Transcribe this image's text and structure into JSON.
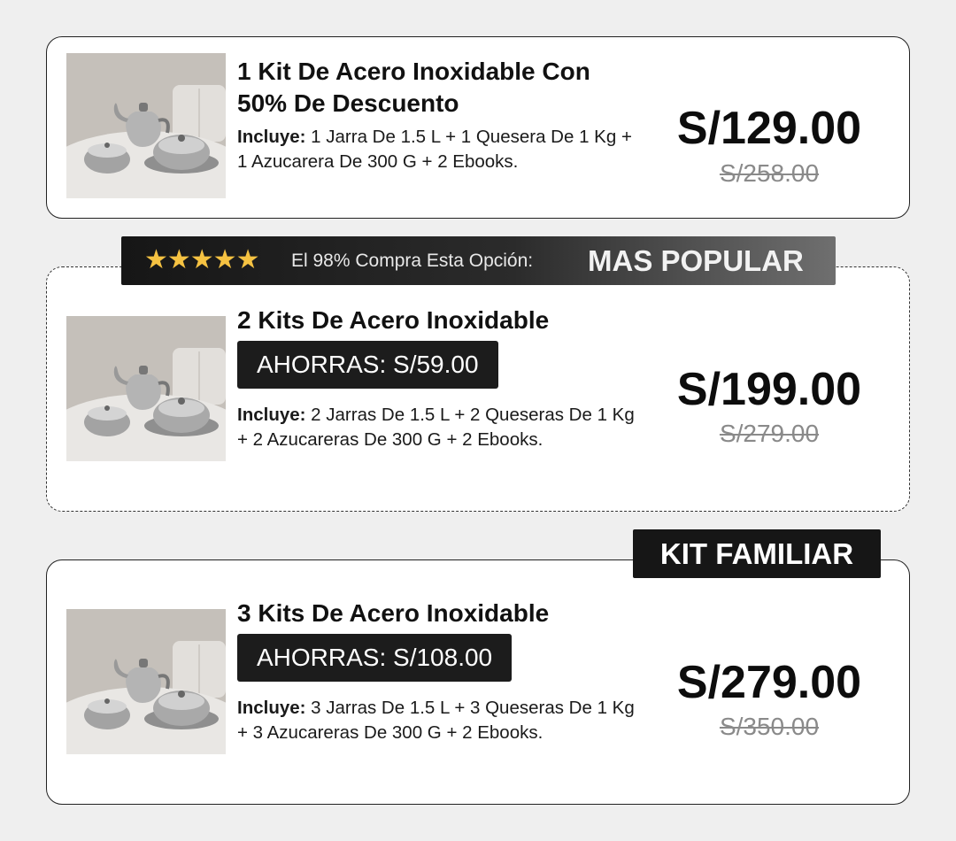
{
  "offers": [
    {
      "title_line1": "1 Kit De Acero Inoxidable Con",
      "title_line2": "50% De Descuento",
      "includes_label": "Incluye:",
      "includes_text": " 1 Jarra De 1.5 L + 1 Quesera De 1 Kg + 1 Azucarera De 300 G + 2 Ebooks.",
      "price": "S/129.00",
      "old_price": "S/258.00"
    },
    {
      "title": "2 Kits De Acero Inoxidable",
      "savings": "AHORRAS: S/59.00",
      "includes_label": "Incluye:",
      "includes_text": " 2 Jarras De 1.5 L + 2 Queseras De 1 Kg + 2 Azucareras De 300 G + 2 Ebooks.",
      "price": "S/199.00",
      "old_price": "S/279.00"
    },
    {
      "title": "3 Kits De Acero Inoxidable",
      "savings": "AHORRAS: S/108.00",
      "includes_label": "Incluye:",
      "includes_text": " 3 Jarras De 1.5 L + 3 Queseras De 1 Kg + 3 Azucareras De 300 G + 2 Ebooks.",
      "price": "S/279.00",
      "old_price": "S/350.00"
    }
  ],
  "popular_banner": {
    "stars": "★★★★★",
    "rating": 5,
    "note": "El 98% Compra Esta Opción:",
    "headline": "MAS POPULAR"
  },
  "family_tag": "KIT FAMILIAR",
  "colors": {
    "page_background": "#efefef",
    "card_background": "#ffffff",
    "star": "#f5c242",
    "pill": "#1c1c1c",
    "old_price": "#8a8a8a"
  },
  "icons": [
    "star-icon",
    "product-photo"
  ]
}
